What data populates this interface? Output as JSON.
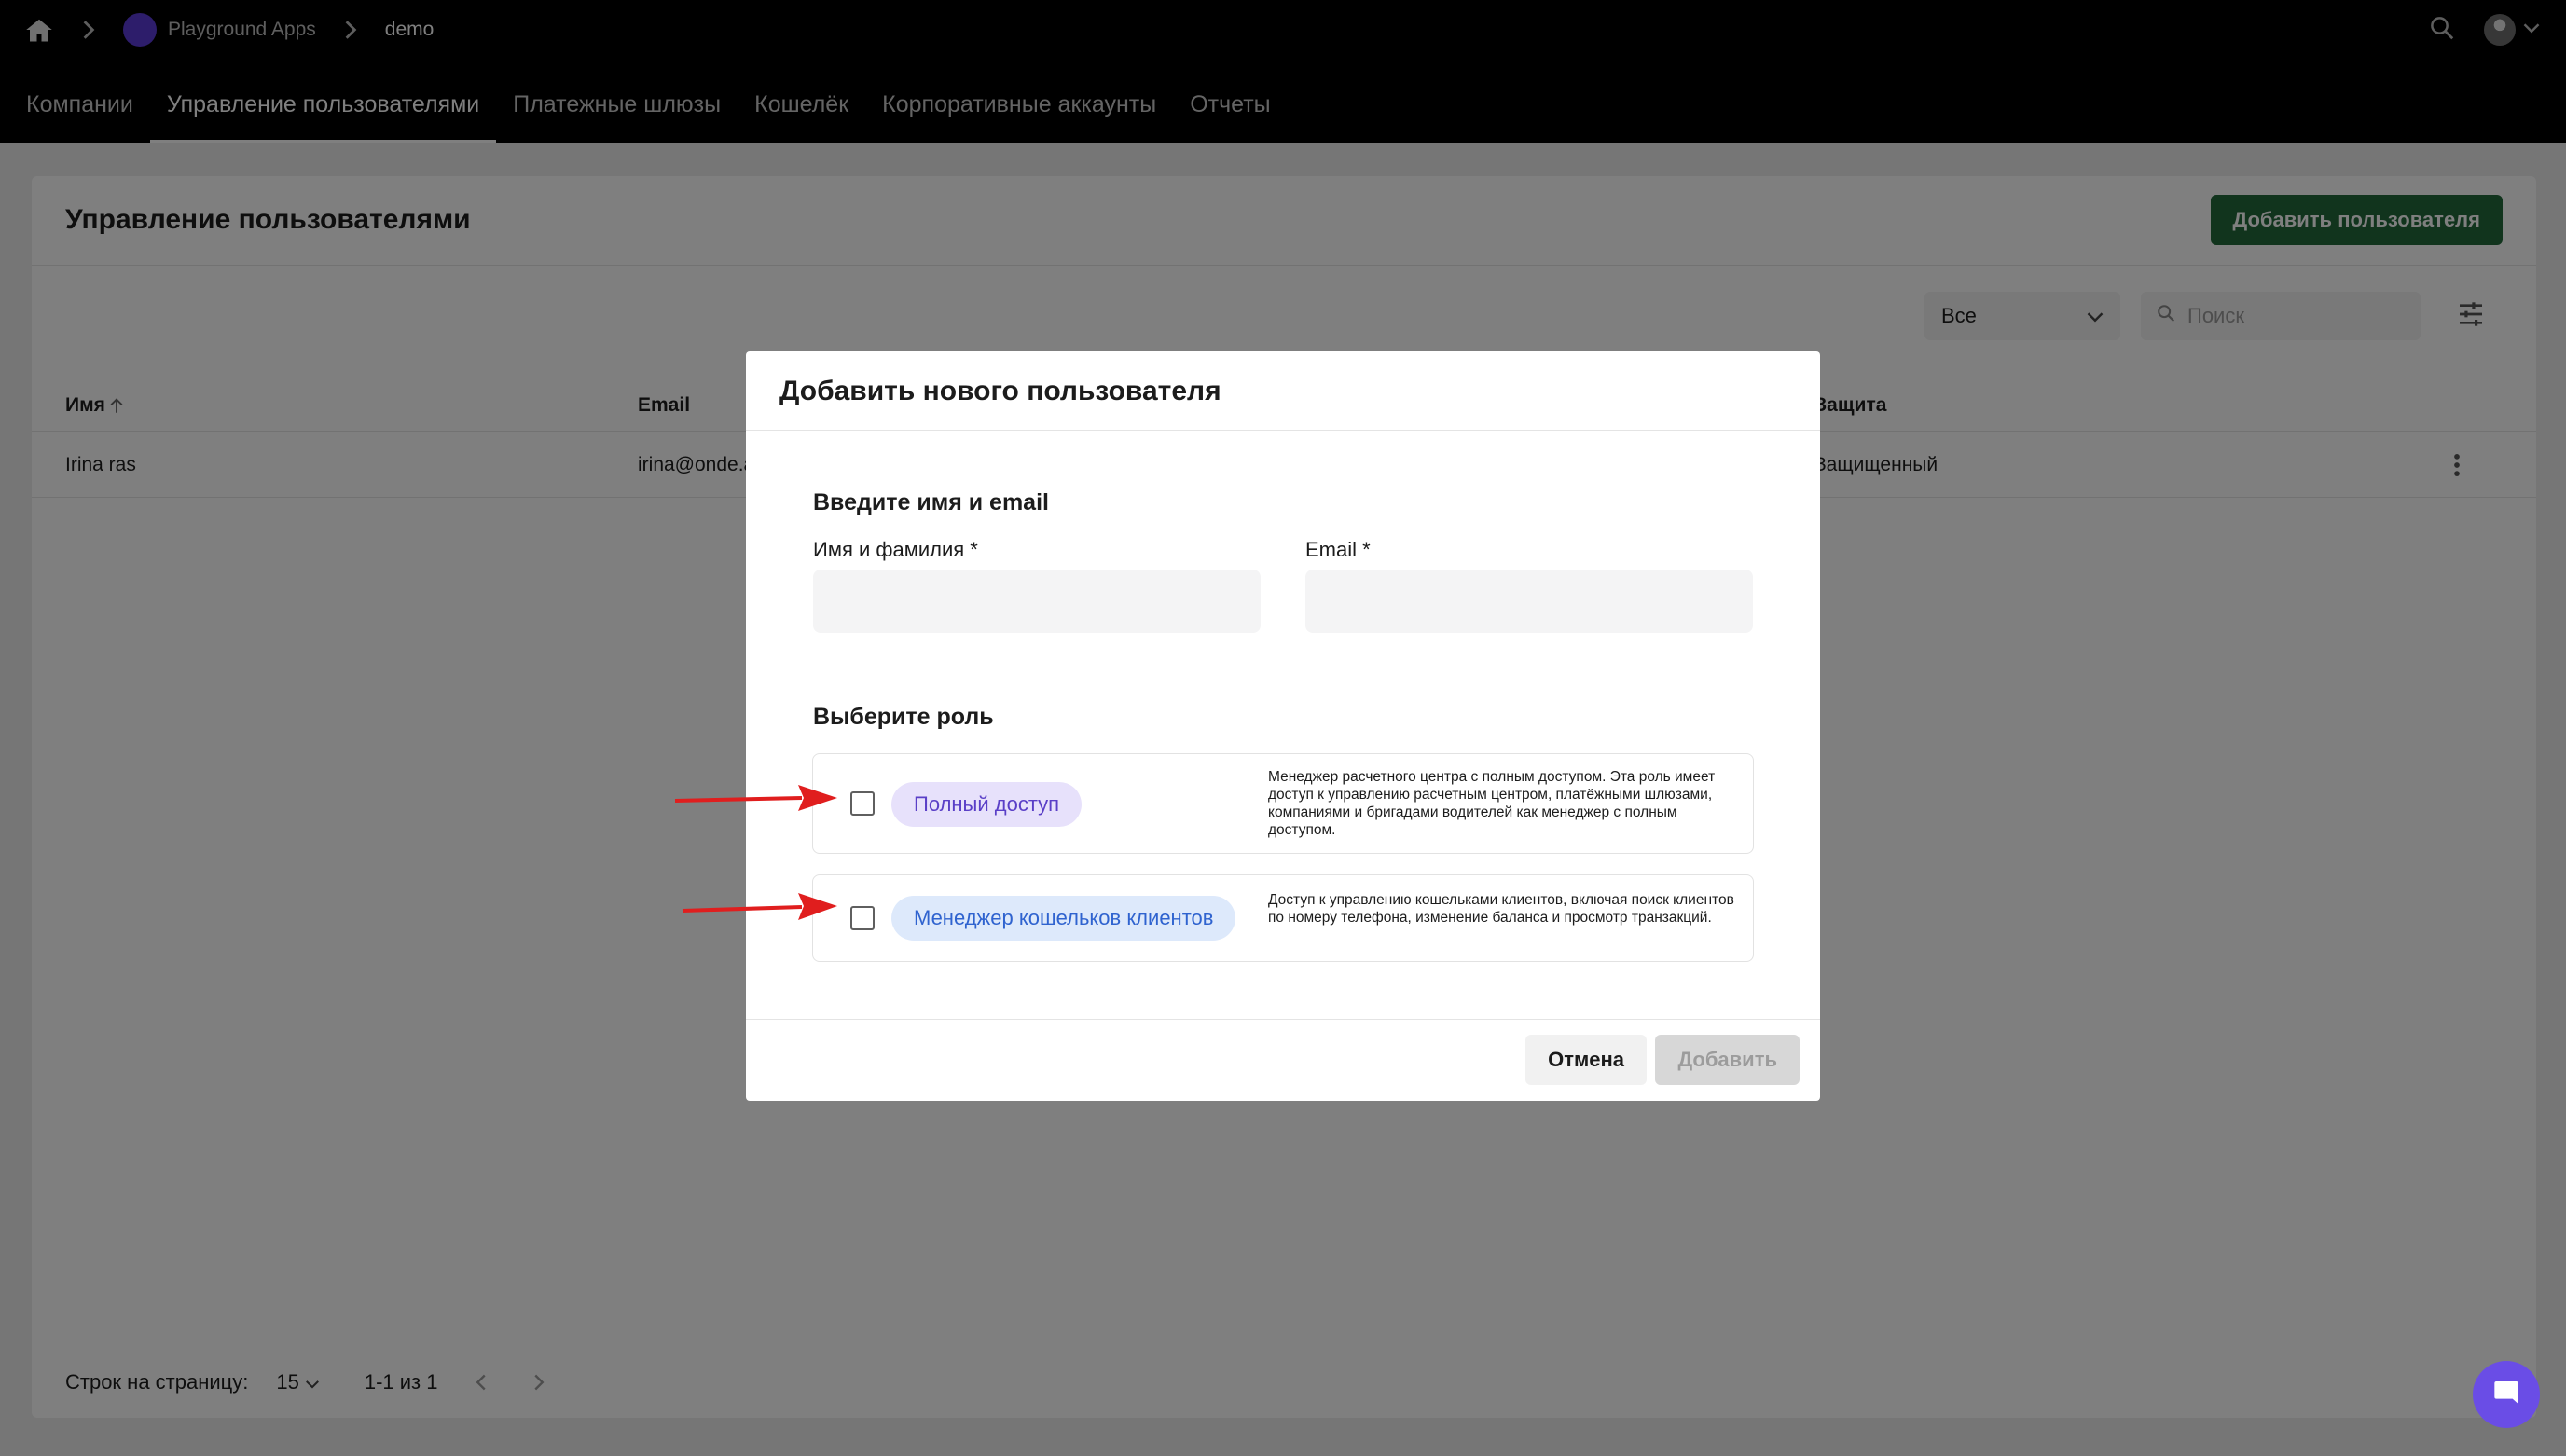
{
  "breadcrumb": {
    "app": "Playground Apps",
    "current": "demo"
  },
  "nav": {
    "tabs": [
      {
        "label": "Компании"
      },
      {
        "label": "Управление пользователями"
      },
      {
        "label": "Платежные шлюзы"
      },
      {
        "label": "Кошелёк"
      },
      {
        "label": "Корпоративные аккаунты"
      },
      {
        "label": "Отчеты"
      }
    ],
    "active": "Управление пользователями"
  },
  "page": {
    "title": "Управление пользователями",
    "add_button": "Добавить пользователя"
  },
  "filters": {
    "select_value": "Все",
    "search_placeholder": "Поиск"
  },
  "table": {
    "headers": {
      "name": "Имя",
      "email": "Email",
      "protection": "Защита"
    },
    "rows": [
      {
        "name": "Irina ras",
        "email": "irina@onde.a",
        "protection": "Защищенный"
      }
    ]
  },
  "pagination": {
    "rows_label": "Строк на страницу:",
    "rows_value": "15",
    "range": "1-1 из 1"
  },
  "modal": {
    "title": "Добавить нового пользователя",
    "section_name": "Введите имя и email",
    "name_label": "Имя и фамилия *",
    "email_label": "Email *",
    "name_value": "",
    "email_value": "",
    "section_role": "Выберите роль",
    "roles": [
      {
        "label": "Полный доступ",
        "description": "Менеджер расчетного центра с полным доступом. Эта роль имеет доступ к управлению расчетным центром, платёжными шлюзами, компаниями и бригадами водителей как менеджер с полным доступом.",
        "checked": false
      },
      {
        "label": "Менеджер кошельков клиентов",
        "description": "Доступ к управлению кошельками клиентов, включая поиск клиентов по номеру телефона, изменение баланса и просмотр транзакций.",
        "checked": false
      }
    ],
    "cancel": "Отмена",
    "submit": "Добавить"
  },
  "colors": {
    "accent_green": "#23683a",
    "role_purple": "#5a3fc7",
    "role_blue": "#2f63cf",
    "annotation_arrow": "#e01e1e",
    "chat": "#6a4de6"
  },
  "icons": [
    "home-icon",
    "chevron-right-icon",
    "search-icon",
    "chevron-down-icon",
    "filter-settings-icon",
    "arrow-up-icon",
    "more-vert-icon",
    "chevron-left-icon",
    "chat-icon"
  ]
}
